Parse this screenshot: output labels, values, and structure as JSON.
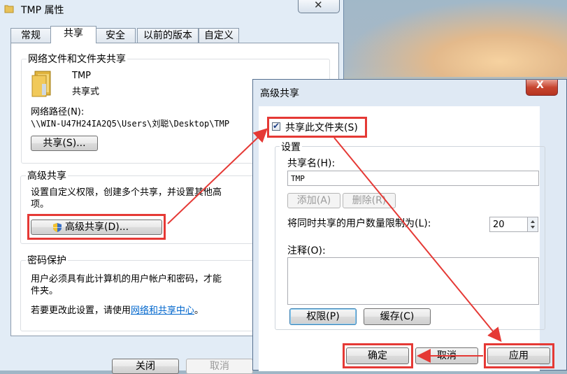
{
  "properties": {
    "title": "TMP 属性",
    "close_glyph": "✕",
    "tabs": [
      "常规",
      "共享",
      "安全",
      "以前的版本",
      "自定义"
    ],
    "network_share": {
      "heading": "网络文件和文件夹共享",
      "folder_name": "TMP",
      "status": "共享式",
      "path_label": "网络路径(N):",
      "path_value": "\\\\WIN-U47H24IA2Q5\\Users\\刘聪\\Desktop\\TMP",
      "share_button": "共享(S)..."
    },
    "advanced_share": {
      "heading": "高级共享",
      "desc_line1": "设置自定义权限，创建多个共享，并设置其他高",
      "desc_line2": "项。",
      "button": "高级共享(D)..."
    },
    "password": {
      "heading": "密码保护",
      "line1": "用户必须具有此计算机的用户帐户和密码，才能",
      "line2": "件夹。",
      "line3_prefix": "若要更改此设置，请使用",
      "link": "网络和共享中心",
      "line3_suffix": "。"
    },
    "footer": {
      "close": "关闭",
      "cancel": "取消"
    }
  },
  "advanced_dialog": {
    "title": "高级共享",
    "close_glyph": "X",
    "share_checkbox": {
      "label": "共享此文件夹(S)",
      "checked": true,
      "check_glyph": "✔"
    },
    "settings_heading": "设置",
    "share_name_label": "共享名(H):",
    "share_name_value": "TMP",
    "add_button": "添加(A)",
    "delete_button": "删除(R)",
    "limit_label": "将同时共享的用户数量限制为(L):",
    "limit_value": "20",
    "comment_label": "注释(O):",
    "permissions_button": "权限(P)",
    "cache_button": "缓存(C)",
    "ok_button": "确定",
    "cancel_button": "取消",
    "apply_button": "应用"
  },
  "colors": {
    "annotation_red": "#e53935",
    "link_blue": "#0066cc",
    "window_frame": "#e2ecf6"
  }
}
